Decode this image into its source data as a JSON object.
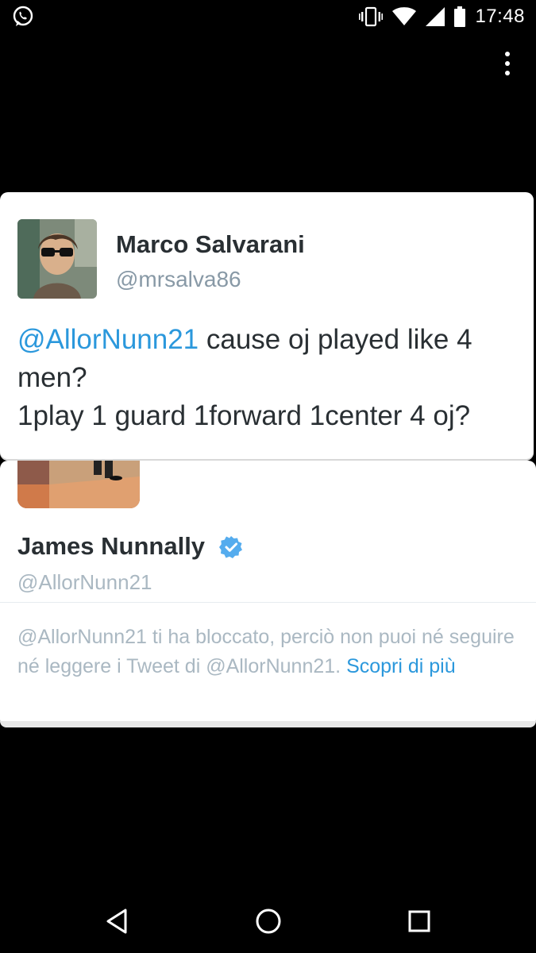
{
  "status_bar": {
    "time": "17:48",
    "icons": [
      "whatsapp-icon",
      "vibrate-icon",
      "wifi-icon",
      "signal-icon",
      "battery-icon"
    ]
  },
  "tweet": {
    "author_name": "Marco Salvarani",
    "author_handle": "@mrsalva86",
    "mention": "@AllorNunn21",
    "text_after_mention": " cause oj played like 4 men?",
    "text_line2": "1play 1 guard 1forward 1center 4 oj?"
  },
  "profile": {
    "name": "James Nunnally",
    "handle": "@AllorNunn21",
    "verified": true,
    "blocked_notice": "@AllorNunn21 ti ha bloccato, perciò non puoi né seguire né leggere i Tweet di @AllorNunn21.",
    "learn_more": "Scopri di più"
  },
  "colors": {
    "accent": "#2b98dc",
    "text": "#292f33",
    "muted": "#8899a6",
    "verified": "#55acee"
  },
  "nav": {
    "icons": [
      "back-icon",
      "home-icon",
      "recents-icon"
    ]
  }
}
